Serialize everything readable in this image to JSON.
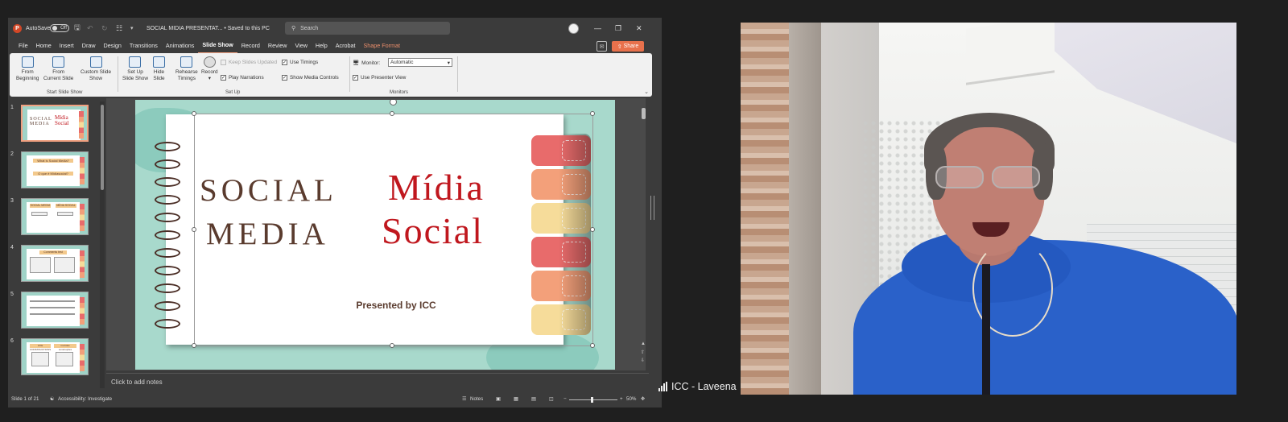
{
  "ppt": {
    "autosave_label": "AutoSave",
    "autosave_state": "Off",
    "doc_title": "SOCIAL MIDIA PRESENTAT... • Saved to this PC",
    "search_placeholder": "Search",
    "menu": [
      "File",
      "Home",
      "Insert",
      "Draw",
      "Design",
      "Transitions",
      "Animations",
      "Slide Show",
      "Record",
      "Review",
      "View",
      "Help",
      "Acrobat",
      "Shape Format"
    ],
    "active_menu": "Slide Show",
    "share_label": "Share",
    "ribbon": {
      "from_beginning": [
        "From",
        "Beginning"
      ],
      "from_current": [
        "From",
        "Current Slide"
      ],
      "custom_show": [
        "Custom Slide",
        "Show"
      ],
      "group_start": "Start Slide Show",
      "setup_show": [
        "Set Up",
        "Slide Show"
      ],
      "hide_slide": [
        "Hide",
        "Slide"
      ],
      "rehearse": [
        "Rehearse",
        "Timings"
      ],
      "record": "Record",
      "keep_updated": "Keep Slides Updated",
      "play_narrations": "Play Narrations",
      "use_timings": "Use Timings",
      "show_media": "Show Media Controls",
      "group_setup": "Set Up",
      "monitor_label": "Monitor:",
      "monitor_value": "Automatic",
      "presenter_view": "Use Presenter View",
      "group_monitors": "Monitors"
    },
    "thumbnails": {
      "numbers": [
        "1",
        "2",
        "3",
        "4",
        "5",
        "6"
      ],
      "slide2_lines": [
        "What is Social Media?",
        "O que é Mídiasocial?"
      ],
      "slide3_heads": [
        "SOCIAL MEDIA",
        "MÍDIA SOCIAL"
      ],
      "slide4_head": "Comments test",
      "slide6_heads": [
        "LIKE CONSTRUCTIONS",
        "Curtidas construções"
      ]
    },
    "slide": {
      "title_en": [
        "SOCIAL",
        "MEDIA"
      ],
      "title_pt": [
        "Mídia",
        "Social"
      ],
      "presented_by": "Presented by ICC"
    },
    "notes_placeholder": "Click to add notes",
    "status": {
      "slide_count": "Slide 1 of 21",
      "accessibility": "Accessibility: Investigate",
      "notes": "Notes",
      "zoom": "50%"
    }
  },
  "video": {
    "participant_name": "ICC - Laveena"
  },
  "colors": {
    "accent_orange": "#e8714c",
    "slide_teal": "#a8d9cc",
    "title_red": "#c0171e",
    "title_brown": "#5a3b2e",
    "hoodie_blue": "#2a61c9"
  }
}
